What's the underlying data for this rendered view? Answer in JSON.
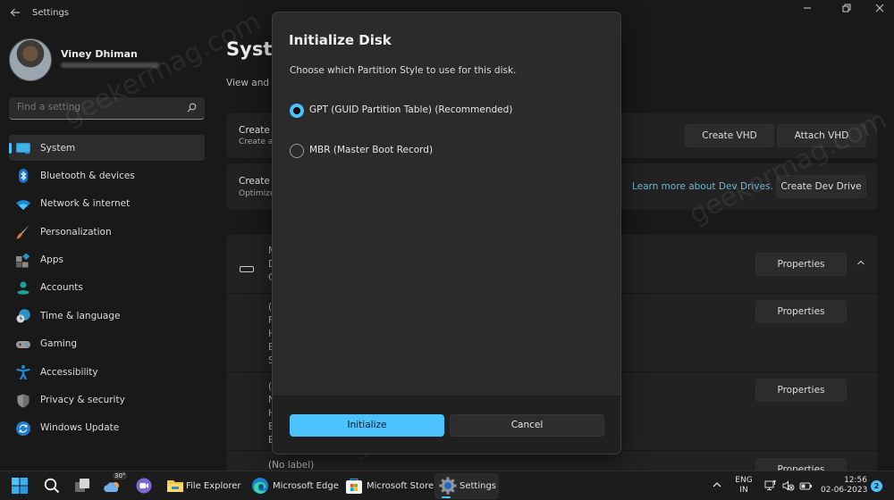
{
  "window": {
    "app_title": "Settings",
    "controls": {
      "minimize": "–",
      "maximize": "❐",
      "close": "✕"
    }
  },
  "profile": {
    "name": "Viney Dhiman",
    "email_blurred": true
  },
  "search": {
    "placeholder": "Find a setting",
    "value": ""
  },
  "sidebar": {
    "items": [
      {
        "label": "System",
        "icon": "monitor-icon",
        "active": true
      },
      {
        "label": "Bluetooth & devices",
        "icon": "bluetooth-icon",
        "active": false
      },
      {
        "label": "Network & internet",
        "icon": "wifi-icon",
        "active": false
      },
      {
        "label": "Personalization",
        "icon": "paintbrush-icon",
        "active": false
      },
      {
        "label": "Apps",
        "icon": "apps-icon",
        "active": false
      },
      {
        "label": "Accounts",
        "icon": "person-icon",
        "active": false
      },
      {
        "label": "Time & language",
        "icon": "globe-clock-icon",
        "active": false
      },
      {
        "label": "Gaming",
        "icon": "gamepad-icon",
        "active": false
      },
      {
        "label": "Accessibility",
        "icon": "accessibility-icon",
        "active": false
      },
      {
        "label": "Privacy & security",
        "icon": "shield-icon",
        "active": false
      },
      {
        "label": "Windows Update",
        "icon": "update-sync-icon",
        "active": false
      }
    ]
  },
  "main": {
    "title_visible": "Syste",
    "description_visible": "View and n",
    "vhd_card": {
      "title_visible": "Create a",
      "sub_visible": "Create ar",
      "create_vhd_label": "Create VHD",
      "attach_vhd_label": "Attach VHD"
    },
    "dev_drive_card": {
      "title_visible": "Create a",
      "sub_visible": "Optimize",
      "learn_more_link": "Learn more about Dev Drives.",
      "create_dev_drive_label": "Create Dev Drive"
    },
    "disk_card": {
      "header_lines_visible": "M\nD\nC",
      "properties_label": "Properties",
      "partitions": [
        {
          "lines_visible": "(I\nF\nH\nE\nS",
          "properties_label": "Properties"
        },
        {
          "lines_visible": "(I\nN\nH\nB\nB",
          "properties_label": "Properties"
        },
        {
          "lines_visible": "(No label)",
          "properties_label": "Properties"
        }
      ]
    }
  },
  "dialog": {
    "title": "Initialize Disk",
    "description": "Choose which Partition Style to use for this disk.",
    "options": [
      {
        "label": "GPT (GUID Partition Table) (Recommended)",
        "checked": true
      },
      {
        "label": "MBR (Master Boot Record)",
        "checked": false
      }
    ],
    "primary_button": "Initialize",
    "secondary_button": "Cancel",
    "accent_color": "#4cc2ff"
  },
  "watermark": "geekermag.com",
  "taskbar": {
    "weather_temp": "30°",
    "apps": [
      {
        "label": "File Explorer",
        "icon": "folder-icon",
        "active": false
      },
      {
        "label": "Microsoft Edge",
        "icon": "edge-icon",
        "active": false
      },
      {
        "label": "Microsoft Store",
        "icon": "store-icon",
        "active": false
      },
      {
        "label": "Settings",
        "icon": "gear-icon",
        "active": true
      }
    ],
    "tray": {
      "language_line1": "ENG",
      "language_line2": "IN",
      "time": "12:56",
      "date": "02-06-2023",
      "notification_count": "2"
    }
  }
}
